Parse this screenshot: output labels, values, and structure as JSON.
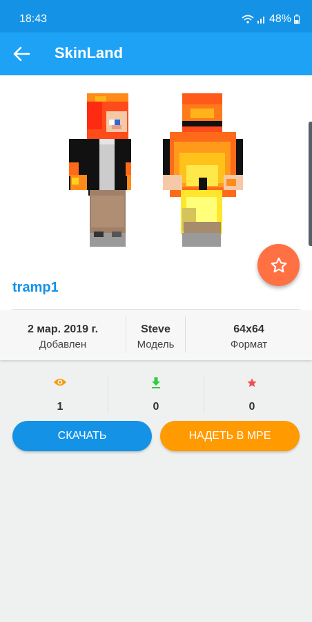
{
  "status_bar": {
    "time": "18:43",
    "battery": "48%"
  },
  "app_bar": {
    "title": "SkinLand",
    "back_icon": "arrow-left-icon"
  },
  "skin": {
    "name": "tramp1"
  },
  "meta": [
    {
      "value": "2 мар. 2019 г.",
      "label": "Добавлен"
    },
    {
      "value": "Steve",
      "label": "Модель"
    },
    {
      "value": "64x64",
      "label": "Формат"
    }
  ],
  "stats": [
    {
      "icon": "eye-icon",
      "count": "1",
      "color": "#f39c12"
    },
    {
      "icon": "download-icon",
      "count": "0",
      "color": "#2ecc40"
    },
    {
      "icon": "star-icon",
      "count": "0",
      "color": "#ef4f4f"
    }
  ],
  "actions": {
    "download_label": "СКАЧАТЬ",
    "apply_label": "НАДЕТЬ В МРЕ"
  },
  "colors": {
    "primary": "#1ea2f5",
    "accent": "#ff9a00",
    "fab": "#ff7043"
  }
}
